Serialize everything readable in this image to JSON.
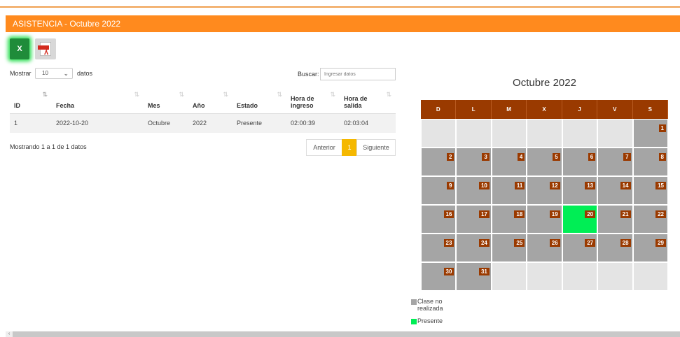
{
  "header": {
    "title": "ASISTENCIA - Octubre 2022"
  },
  "export": {
    "excel_label": "X"
  },
  "table_controls": {
    "show_label": "Mostrar",
    "page_size": "10",
    "entries_label": "datos",
    "search_label": "Buscar:",
    "search_placeholder": "Ingresar datos"
  },
  "table": {
    "columns": [
      "ID",
      "Fecha",
      "Mes",
      "Año",
      "Estado",
      "Hora de ingreso",
      "Hora de salida"
    ],
    "rows": [
      [
        "1",
        "2022-10-20",
        "Octubre",
        "2022",
        "Presente",
        "02:00:39",
        "02:03:04"
      ]
    ],
    "info": "Mostrando 1 a 1 de 1 datos"
  },
  "pagination": {
    "prev": "Anterior",
    "current": "1",
    "next": "Siguiente"
  },
  "calendar": {
    "title": "Octubre 2022",
    "weekdays": [
      "D",
      "L",
      "M",
      "X",
      "J",
      "V",
      "S"
    ],
    "first_weekday_index": 6,
    "days_in_month": 31,
    "present_days": [
      20
    ],
    "colors": {
      "header": "#9a3a00",
      "no_class": "#a5a5a5",
      "present": "#00ee55",
      "empty": "#e4e4e4"
    }
  },
  "legend": {
    "no_class": "Clase no realizada",
    "present": "Presente"
  },
  "colors": {
    "brand": "#ff8a1e",
    "page_active": "#f5b800"
  }
}
